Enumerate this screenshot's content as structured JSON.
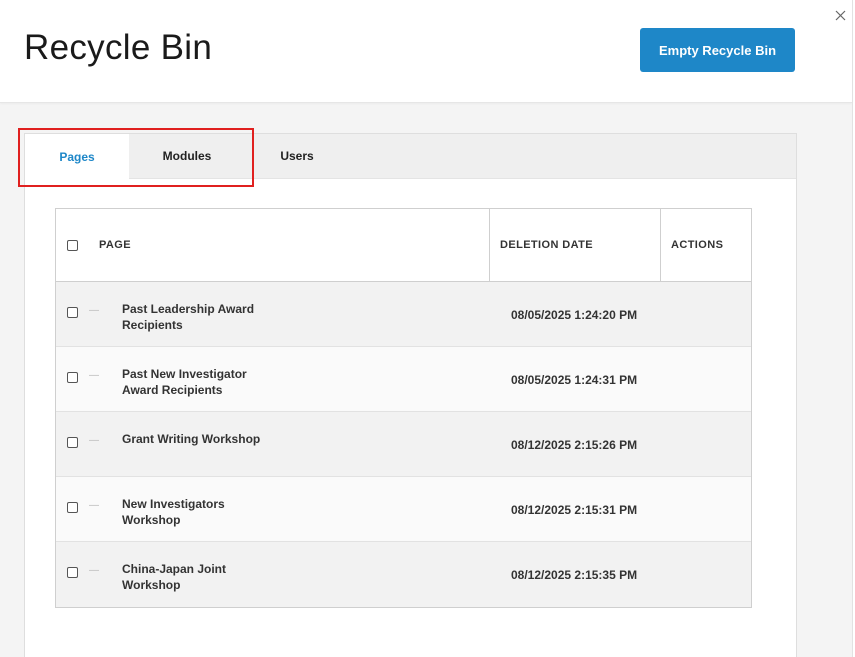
{
  "header": {
    "title": "Recycle Bin",
    "empty_button_label": "Empty Recycle Bin"
  },
  "tabs": [
    {
      "label": "Pages",
      "active": true
    },
    {
      "label": "Modules",
      "active": false
    },
    {
      "label": "Users",
      "active": false
    }
  ],
  "table": {
    "columns": {
      "page": "PAGE",
      "deletion_date": "DELETION DATE",
      "actions": "ACTIONS"
    },
    "rows": [
      {
        "name": "Past Leadership Award Recipients",
        "date": "08/05/2025 1:24:20 PM"
      },
      {
        "name": "Past New Investigator Award Recipients",
        "date": "08/05/2025 1:24:31 PM"
      },
      {
        "name": "Grant Writing Workshop",
        "date": "08/12/2025 2:15:26 PM"
      },
      {
        "name": "New Investigators Workshop",
        "date": "08/12/2025 2:15:31 PM"
      },
      {
        "name": "China-Japan Joint Workshop",
        "date": "08/12/2025 2:15:35 PM"
      }
    ]
  },
  "icons": {
    "close": "close-icon",
    "row_dash": "dash-icon"
  },
  "colors": {
    "accent": "#1e87c8",
    "highlight_border": "#e0201f"
  }
}
